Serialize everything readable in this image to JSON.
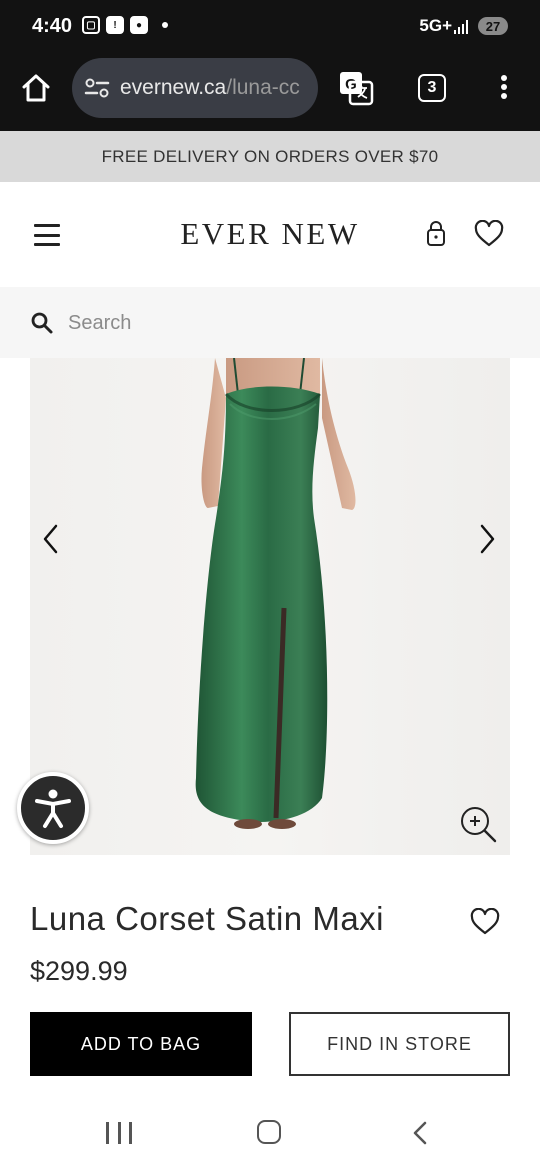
{
  "status_bar": {
    "time": "4:40",
    "network": "5G+",
    "battery": "27",
    "left_icons": [
      "screenshot-icon",
      "alert-icon",
      "media-icon"
    ]
  },
  "browser": {
    "url_domain": "evernew.ca",
    "url_path": "/luna-cc",
    "tab_count": "3"
  },
  "promo": {
    "text": "FREE DELIVERY ON ORDERS OVER $70"
  },
  "header": {
    "logo": "EVER NEW"
  },
  "search": {
    "placeholder": "Search"
  },
  "product": {
    "title": "Luna Corset Satin Maxi",
    "price": "$299.99",
    "dress_color": "#2d6a45",
    "add_to_bag": "ADD TO BAG",
    "find_in_store": "FIND IN STORE"
  }
}
